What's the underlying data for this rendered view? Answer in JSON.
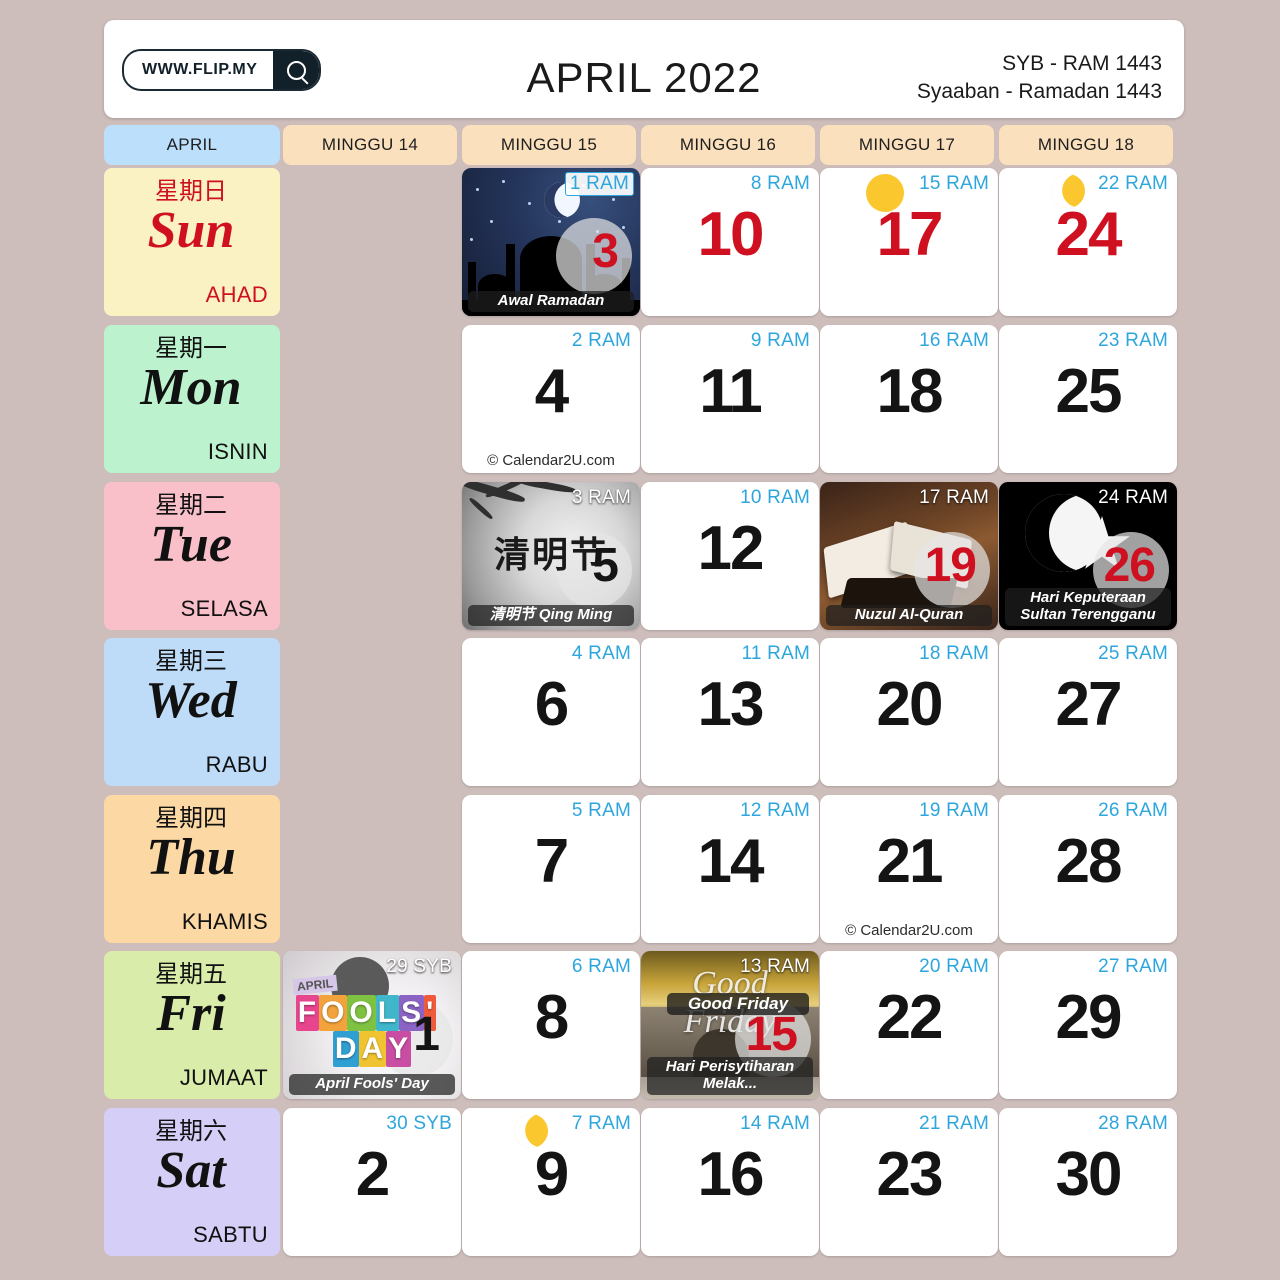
{
  "header": {
    "logo_text": "WWW.FLIP.MY",
    "search_icon": "search-icon",
    "month_title": "APRIL 2022",
    "hijri_short": "SYB - RAM 1443",
    "hijri_long": "Syaaban - Ramadan 1443"
  },
  "week_header": {
    "month_label": "APRIL",
    "weeks": [
      "MINGGU 14",
      "MINGGU 15",
      "MINGGU 16",
      "MINGGU 17",
      "MINGGU 18"
    ]
  },
  "day_rows": [
    {
      "cn": "星期日",
      "en": "Sun",
      "ms": "AHAD",
      "bg": "#fbf2c4",
      "fg": "#cf1020"
    },
    {
      "cn": "星期一",
      "en": "Mon",
      "ms": "ISNIN",
      "bg": "#bdf2cf",
      "fg": "#111111"
    },
    {
      "cn": "星期二",
      "en": "Tue",
      "ms": "SELASA",
      "bg": "#f9c0ca",
      "fg": "#111111"
    },
    {
      "cn": "星期三",
      "en": "Wed",
      "ms": "RABU",
      "bg": "#bedcf8",
      "fg": "#111111"
    },
    {
      "cn": "星期四",
      "en": "Thu",
      "ms": "KHAMIS",
      "bg": "#fbd8a4",
      "fg": "#111111"
    },
    {
      "cn": "星期五",
      "en": "Fri",
      "ms": "JUMAAT",
      "bg": "#d9ecaa",
      "fg": "#111111"
    },
    {
      "cn": "星期六",
      "en": "Sat",
      "ms": "SABTU",
      "bg": "#d5cef7",
      "fg": "#111111"
    }
  ],
  "colors": {
    "page_background": "#cdbdbb",
    "card_background": "#ffffff",
    "hijri_label": "#2ca6dd",
    "holiday_red": "#cf1020",
    "month_chip": "#bcdffb",
    "week_chip": "#fbe0bd",
    "sun_marker": "#fbc72e"
  },
  "watermark": "© Calendar2U.com",
  "cells": [
    {
      "row": 0,
      "col": 0,
      "empty": true
    },
    {
      "row": 0,
      "col": 1,
      "day": "3",
      "hijri": "1 RAM",
      "art": "mosque",
      "event": "Awal Ramadan",
      "hijri_style": "boxed",
      "daynum_color": "red"
    },
    {
      "row": 0,
      "col": 2,
      "day": "10",
      "hijri": "8 RAM",
      "daynum_color": "red"
    },
    {
      "row": 0,
      "col": 3,
      "day": "17",
      "hijri": "15 RAM",
      "daynum_color": "red",
      "marker": "sun"
    },
    {
      "row": 0,
      "col": 4,
      "day": "24",
      "hijri": "22 RAM",
      "daynum_color": "red",
      "marker": "moon"
    },
    {
      "row": 1,
      "col": 0,
      "empty": true
    },
    {
      "row": 1,
      "col": 1,
      "day": "4",
      "hijri": "2 RAM",
      "watermark": true
    },
    {
      "row": 1,
      "col": 2,
      "day": "11",
      "hijri": "9 RAM"
    },
    {
      "row": 1,
      "col": 3,
      "day": "18",
      "hijri": "16 RAM"
    },
    {
      "row": 1,
      "col": 4,
      "day": "25",
      "hijri": "23 RAM"
    },
    {
      "row": 2,
      "col": 0,
      "empty": true
    },
    {
      "row": 2,
      "col": 1,
      "day": "5",
      "hijri": "3 RAM",
      "art": "qingming",
      "event": "清明节 Qing Ming",
      "hijri_style": "onimg",
      "cn_overlay": "清明节"
    },
    {
      "row": 2,
      "col": 2,
      "day": "12",
      "hijri": "10 RAM"
    },
    {
      "row": 2,
      "col": 3,
      "day": "19",
      "hijri": "17 RAM",
      "art": "quran",
      "event": "Nuzul Al-Quran",
      "hijri_style": "onimg",
      "daynum_color": "red"
    },
    {
      "row": 2,
      "col": 4,
      "day": "26",
      "hijri": "24 RAM",
      "art": "crescentstar",
      "event": "Hari Keputeraan Sultan Terengganu",
      "hijri_style": "onimg",
      "daynum_color": "red"
    },
    {
      "row": 3,
      "col": 0,
      "empty": true
    },
    {
      "row": 3,
      "col": 1,
      "day": "6",
      "hijri": "4 RAM"
    },
    {
      "row": 3,
      "col": 2,
      "day": "13",
      "hijri": "11 RAM"
    },
    {
      "row": 3,
      "col": 3,
      "day": "20",
      "hijri": "18 RAM"
    },
    {
      "row": 3,
      "col": 4,
      "day": "27",
      "hijri": "25 RAM"
    },
    {
      "row": 4,
      "col": 0,
      "empty": true
    },
    {
      "row": 4,
      "col": 1,
      "day": "7",
      "hijri": "5 RAM"
    },
    {
      "row": 4,
      "col": 2,
      "day": "14",
      "hijri": "12 RAM"
    },
    {
      "row": 4,
      "col": 3,
      "day": "21",
      "hijri": "19 RAM",
      "watermark": true
    },
    {
      "row": 4,
      "col": 4,
      "day": "28",
      "hijri": "26 RAM"
    },
    {
      "row": 5,
      "col": 0,
      "day": "1",
      "hijri": "29 SYB",
      "art": "aprilfools",
      "event": "April Fools' Day",
      "hijri_style": "onimg",
      "af_word": "FOOLS' DAY",
      "af_sub": "APRIL"
    },
    {
      "row": 5,
      "col": 1,
      "day": "8",
      "hijri": "6 RAM"
    },
    {
      "row": 5,
      "col": 2,
      "day": "15",
      "hijri": "13 RAM",
      "art": "goodfriday",
      "event": "Hari Perisytiharan Melak...",
      "hijri_style": "onimg",
      "gf_script": "Good Friday",
      "gf_badge": "Good Friday",
      "daynum_color": "red"
    },
    {
      "row": 5,
      "col": 3,
      "day": "22",
      "hijri": "20 RAM"
    },
    {
      "row": 5,
      "col": 4,
      "day": "29",
      "hijri": "27 RAM"
    },
    {
      "row": 6,
      "col": 0,
      "day": "2",
      "hijri": "30 SYB"
    },
    {
      "row": 6,
      "col": 1,
      "day": "9",
      "hijri": "7 RAM",
      "marker": "moon"
    },
    {
      "row": 6,
      "col": 2,
      "day": "16",
      "hijri": "14 RAM"
    },
    {
      "row": 6,
      "col": 3,
      "day": "23",
      "hijri": "21 RAM"
    },
    {
      "row": 6,
      "col": 4,
      "day": "30",
      "hijri": "28 RAM"
    }
  ]
}
